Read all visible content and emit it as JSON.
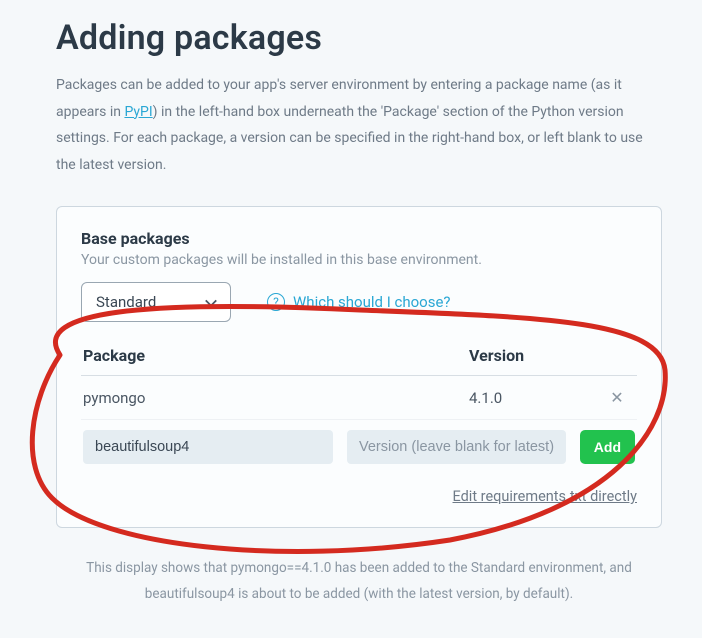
{
  "heading": "Adding packages",
  "intro_before": "Packages can be added to your app's server environment by entering a package name (as it appears in ",
  "intro_link": "PyPI",
  "intro_after": ") in the left-hand box underneath the 'Package' section of the Python version settings. For each package, a version can be specified in the right-hand box, or left blank to use the latest version.",
  "base_title": "Base packages",
  "base_sub": "Your custom packages will be installed in this base environment.",
  "dropdown_value": "Standard",
  "help_text": "Which should I choose?",
  "col_package": "Package",
  "col_version": "Version",
  "rows": [
    {
      "name": "pymongo",
      "version": "4.1.0"
    }
  ],
  "new_package_value": "beautifulsoup4",
  "version_placeholder": "Version (leave blank for latest)",
  "add_label": "Add",
  "edit_req_label": "Edit requirements.txt directly",
  "caption_line1": "This display shows that pymongo==4.1.0 has been added to the Standard environment, and",
  "caption_line2": "beautifulsoup4 is about to be added (with the latest version, by default)."
}
